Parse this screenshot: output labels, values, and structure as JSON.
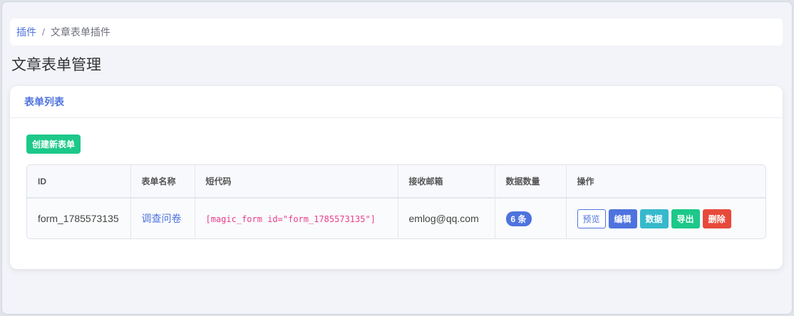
{
  "breadcrumb": {
    "parent": "插件",
    "separator": "/",
    "current": "文章表单插件"
  },
  "page": {
    "title": "文章表单管理"
  },
  "card": {
    "header": "表单列表",
    "create_label": "创建新表单"
  },
  "table": {
    "columns": [
      "ID",
      "表单名称",
      "短代码",
      "接收邮箱",
      "数据数量",
      "操作"
    ],
    "rows": [
      {
        "id": "form_1785573135",
        "name": "调查问卷",
        "shortcode": "[magic_form id=\"form_1785573135\"]",
        "email": "emlog@qq.com",
        "count": "6 条",
        "actions": {
          "preview": "预览",
          "edit": "编辑",
          "data": "数据",
          "export": "导出",
          "delete": "删除"
        }
      }
    ]
  },
  "colors": {
    "primary": "#4e73df",
    "success": "#1cc88a",
    "info": "#36b9cc",
    "danger": "#e74a3b",
    "code": "#e83e8c"
  }
}
